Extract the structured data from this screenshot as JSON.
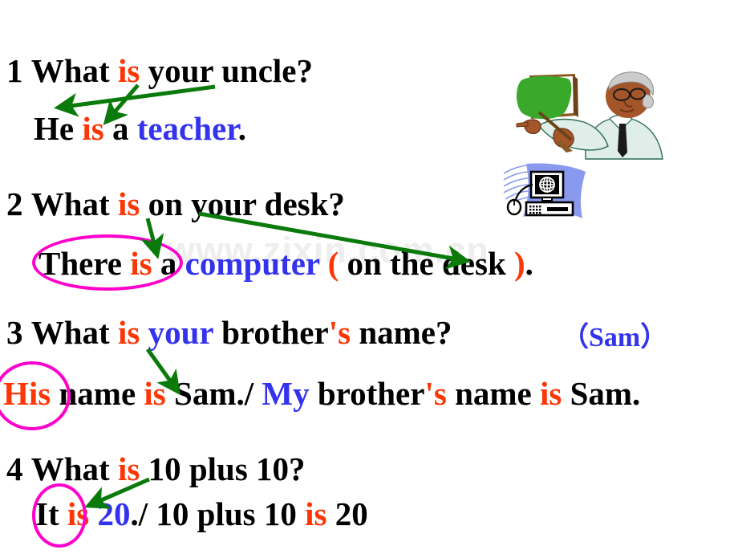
{
  "slide": {
    "watermark": "www.zixin.com.cn",
    "colors": {
      "text": "#000000",
      "accent_red": "#fc3605",
      "accent_blue": "#3333ee",
      "circle_magenta": "#ff00cc",
      "arrow_green": "#0a7a0a",
      "chalkboard_green": "#3aa82a",
      "clipart_blue": "#8899ee"
    }
  },
  "items": [
    {
      "number": "1",
      "question": {
        "pre": "What ",
        "highlight": "is",
        "post": " your uncle?"
      },
      "answer": {
        "parts": [
          {
            "text": "He ",
            "color": "black"
          },
          {
            "text": "is",
            "color": "red"
          },
          {
            "text": " a ",
            "color": "black"
          },
          {
            "text": "teacher",
            "color": "blue"
          },
          {
            "text": ".",
            "color": "black"
          }
        ]
      }
    },
    {
      "number": "2",
      "question": {
        "pre": "What ",
        "highlight": "is",
        "post": " on your desk?"
      },
      "answer": {
        "parts": [
          {
            "text": "There ",
            "color": "black"
          },
          {
            "text": "is",
            "color": "red"
          },
          {
            "text": " a ",
            "color": "black"
          },
          {
            "text": "computer",
            "color": "blue"
          },
          {
            "text": " (",
            "color": "red"
          },
          {
            "text": " on the desk ",
            "color": "black"
          },
          {
            "text": ")",
            "color": "red"
          },
          {
            "text": ".",
            "color": "black"
          }
        ]
      }
    },
    {
      "number": "3",
      "question": {
        "pre": "What ",
        "highlight": "is",
        "mid": " ",
        "highlight2": "your",
        "post": " brother",
        "apostrophe": "'s",
        "tail": " name?"
      },
      "hint": "（Sam）",
      "answer": {
        "parts": [
          {
            "text": "His",
            "color": "red"
          },
          {
            "text": " name ",
            "color": "black"
          },
          {
            "text": "is",
            "color": "red"
          },
          {
            "text": " Sam./ ",
            "color": "black"
          },
          {
            "text": "My",
            "color": "blue"
          },
          {
            "text": " brother",
            "color": "black"
          },
          {
            "text": "'s",
            "color": "red"
          },
          {
            "text": " name ",
            "color": "black"
          },
          {
            "text": "is",
            "color": "red"
          },
          {
            "text": " Sam.",
            "color": "black"
          }
        ]
      }
    },
    {
      "number": "4",
      "question": {
        "pre": "What ",
        "highlight": "is",
        "post": " 10 plus 10?"
      },
      "answer": {
        "parts": [
          {
            "text": "It",
            "color": "black"
          },
          {
            "text": " is",
            "color": "red"
          },
          {
            "text": " 20",
            "color": "blue"
          },
          {
            "text": "./   ",
            "color": "black"
          },
          {
            "text": "10 plus 10 ",
            "color": "black"
          },
          {
            "text": "is",
            "color": "red"
          },
          {
            "text": " 20",
            "color": "black"
          }
        ]
      }
    }
  ],
  "lines": {
    "l1q_num": "1",
    "l1q_a": "What ",
    "l1q_is": "is",
    "l1q_b": " your uncle?",
    "l1a_he": "He ",
    "l1a_is": "is",
    "l1a_a": " a ",
    "l1a_teacher": "teacher",
    "l1a_dot": ".",
    "l2q_num": "2",
    "l2q_a": "What ",
    "l2q_is": "is",
    "l2q_b": " on your desk?",
    "l2a_there": "There ",
    "l2a_is": "is",
    "l2a_a": " a ",
    "l2a_computer": "computer",
    "l2a_open": " (",
    "l2a_mid": " on the desk ",
    "l2a_close": ")",
    "l2a_dot": ".",
    "l3q_num": "3",
    "l3q_a": "What ",
    "l3q_is": "is",
    "l3q_sp": " ",
    "l3q_your": "your",
    "l3q_b": " brother",
    "l3q_apos": "'s",
    "l3q_c": " name?",
    "l3_hint": "（Sam）",
    "l3a_his": "His",
    "l3a_name1": " name ",
    "l3a_is1": "is",
    "l3a_sam1": " Sam./ ",
    "l3a_my": "My",
    "l3a_brother": " brother",
    "l3a_apos": "'s",
    "l3a_name2": " name ",
    "l3a_is2": "is",
    "l3a_sam2": " Sam.",
    "l4q_num": "4",
    "l4q_a": "What ",
    "l4q_is": "is",
    "l4q_b": " 10 plus 10?",
    "l4a_it": "It",
    "l4a_is1": " is",
    "l4a_20a": " 20",
    "l4a_slash": "./",
    "l4a_gap": "   ",
    "l4a_plus": "10 plus 10 ",
    "l4a_is2": "is",
    "l4a_20b": " 20"
  }
}
